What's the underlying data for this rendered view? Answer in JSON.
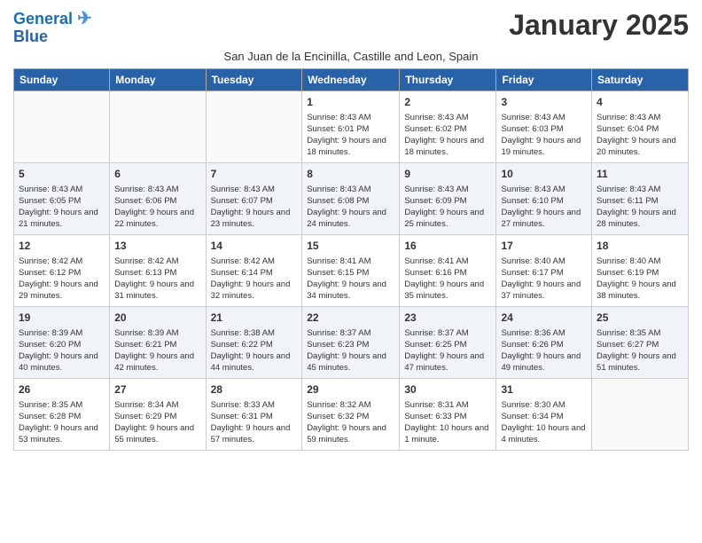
{
  "header": {
    "logo_line1": "General",
    "logo_line2": "Blue",
    "month_title": "January 2025",
    "subtitle": "San Juan de la Encinilla, Castille and Leon, Spain"
  },
  "weekdays": [
    "Sunday",
    "Monday",
    "Tuesday",
    "Wednesday",
    "Thursday",
    "Friday",
    "Saturday"
  ],
  "weeks": [
    [
      {
        "day": "",
        "info": ""
      },
      {
        "day": "",
        "info": ""
      },
      {
        "day": "",
        "info": ""
      },
      {
        "day": "1",
        "info": "Sunrise: 8:43 AM\nSunset: 6:01 PM\nDaylight: 9 hours and 18 minutes."
      },
      {
        "day": "2",
        "info": "Sunrise: 8:43 AM\nSunset: 6:02 PM\nDaylight: 9 hours and 18 minutes."
      },
      {
        "day": "3",
        "info": "Sunrise: 8:43 AM\nSunset: 6:03 PM\nDaylight: 9 hours and 19 minutes."
      },
      {
        "day": "4",
        "info": "Sunrise: 8:43 AM\nSunset: 6:04 PM\nDaylight: 9 hours and 20 minutes."
      }
    ],
    [
      {
        "day": "5",
        "info": "Sunrise: 8:43 AM\nSunset: 6:05 PM\nDaylight: 9 hours and 21 minutes."
      },
      {
        "day": "6",
        "info": "Sunrise: 8:43 AM\nSunset: 6:06 PM\nDaylight: 9 hours and 22 minutes."
      },
      {
        "day": "7",
        "info": "Sunrise: 8:43 AM\nSunset: 6:07 PM\nDaylight: 9 hours and 23 minutes."
      },
      {
        "day": "8",
        "info": "Sunrise: 8:43 AM\nSunset: 6:08 PM\nDaylight: 9 hours and 24 minutes."
      },
      {
        "day": "9",
        "info": "Sunrise: 8:43 AM\nSunset: 6:09 PM\nDaylight: 9 hours and 25 minutes."
      },
      {
        "day": "10",
        "info": "Sunrise: 8:43 AM\nSunset: 6:10 PM\nDaylight: 9 hours and 27 minutes."
      },
      {
        "day": "11",
        "info": "Sunrise: 8:43 AM\nSunset: 6:11 PM\nDaylight: 9 hours and 28 minutes."
      }
    ],
    [
      {
        "day": "12",
        "info": "Sunrise: 8:42 AM\nSunset: 6:12 PM\nDaylight: 9 hours and 29 minutes."
      },
      {
        "day": "13",
        "info": "Sunrise: 8:42 AM\nSunset: 6:13 PM\nDaylight: 9 hours and 31 minutes."
      },
      {
        "day": "14",
        "info": "Sunrise: 8:42 AM\nSunset: 6:14 PM\nDaylight: 9 hours and 32 minutes."
      },
      {
        "day": "15",
        "info": "Sunrise: 8:41 AM\nSunset: 6:15 PM\nDaylight: 9 hours and 34 minutes."
      },
      {
        "day": "16",
        "info": "Sunrise: 8:41 AM\nSunset: 6:16 PM\nDaylight: 9 hours and 35 minutes."
      },
      {
        "day": "17",
        "info": "Sunrise: 8:40 AM\nSunset: 6:17 PM\nDaylight: 9 hours and 37 minutes."
      },
      {
        "day": "18",
        "info": "Sunrise: 8:40 AM\nSunset: 6:19 PM\nDaylight: 9 hours and 38 minutes."
      }
    ],
    [
      {
        "day": "19",
        "info": "Sunrise: 8:39 AM\nSunset: 6:20 PM\nDaylight: 9 hours and 40 minutes."
      },
      {
        "day": "20",
        "info": "Sunrise: 8:39 AM\nSunset: 6:21 PM\nDaylight: 9 hours and 42 minutes."
      },
      {
        "day": "21",
        "info": "Sunrise: 8:38 AM\nSunset: 6:22 PM\nDaylight: 9 hours and 44 minutes."
      },
      {
        "day": "22",
        "info": "Sunrise: 8:37 AM\nSunset: 6:23 PM\nDaylight: 9 hours and 45 minutes."
      },
      {
        "day": "23",
        "info": "Sunrise: 8:37 AM\nSunset: 6:25 PM\nDaylight: 9 hours and 47 minutes."
      },
      {
        "day": "24",
        "info": "Sunrise: 8:36 AM\nSunset: 6:26 PM\nDaylight: 9 hours and 49 minutes."
      },
      {
        "day": "25",
        "info": "Sunrise: 8:35 AM\nSunset: 6:27 PM\nDaylight: 9 hours and 51 minutes."
      }
    ],
    [
      {
        "day": "26",
        "info": "Sunrise: 8:35 AM\nSunset: 6:28 PM\nDaylight: 9 hours and 53 minutes."
      },
      {
        "day": "27",
        "info": "Sunrise: 8:34 AM\nSunset: 6:29 PM\nDaylight: 9 hours and 55 minutes."
      },
      {
        "day": "28",
        "info": "Sunrise: 8:33 AM\nSunset: 6:31 PM\nDaylight: 9 hours and 57 minutes."
      },
      {
        "day": "29",
        "info": "Sunrise: 8:32 AM\nSunset: 6:32 PM\nDaylight: 9 hours and 59 minutes."
      },
      {
        "day": "30",
        "info": "Sunrise: 8:31 AM\nSunset: 6:33 PM\nDaylight: 10 hours and 1 minute."
      },
      {
        "day": "31",
        "info": "Sunrise: 8:30 AM\nSunset: 6:34 PM\nDaylight: 10 hours and 4 minutes."
      },
      {
        "day": "",
        "info": ""
      }
    ]
  ]
}
